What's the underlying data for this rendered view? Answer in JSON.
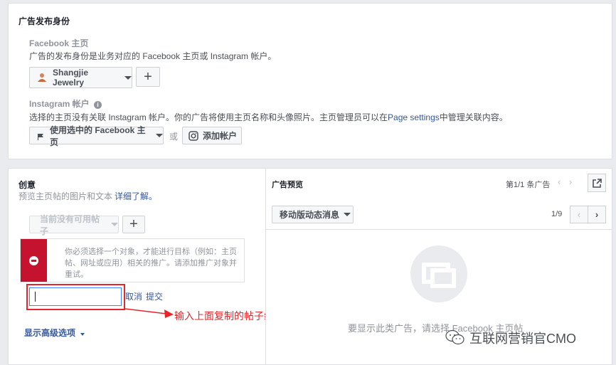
{
  "publisher": {
    "section_title": "广告发布身份",
    "facebook_title": "Facebook 主页",
    "facebook_desc": "广告的发布身份是业务对应的 Facebook 主页或 Instagram 帐户。",
    "page_select_label": "Shangjie Jewelry",
    "add_page_label": "+",
    "instagram_title": "Instagram 帐户",
    "instagram_desc_pre": "选择的主页没有关联 Instagram 帐户。你的广告将使用主页名称和头像照片。主页管理员可以在",
    "instagram_desc_link": "Page settings",
    "instagram_desc_post": "中管理关联内容。",
    "use_page_label": "使用选中的 Facebook 主页",
    "or_label": "或",
    "add_account_label": "添加帐户"
  },
  "creative": {
    "title": "创意",
    "desc": "预览主页帖的图片和文本",
    "learn_more": "详细了解。",
    "no_post_label": "当前没有可用帖子",
    "add_post_label": "+",
    "warning": "你必须选择一个对象，才能进行目标（例如：主页帖、网址或应用）相关的推广。请添加推广对象并重试。",
    "post_id_value": "",
    "cancel_label": "取消",
    "submit_label": "提交",
    "advanced_label": "显示高级选项",
    "annotation": "输入上面复制的帖子编号"
  },
  "preview": {
    "title": "广告预览",
    "counter": "第1/1 条广告",
    "placement_label": "移动版动态消息",
    "page_counter": "1/9",
    "empty_msg": "要显示此类广告，请选择 Facebook 主页帖"
  },
  "watermark": "互联网营销官CMO",
  "colors": {
    "link": "#365899",
    "warning_strip": "#c4122f",
    "annotation": "#e8252a"
  }
}
